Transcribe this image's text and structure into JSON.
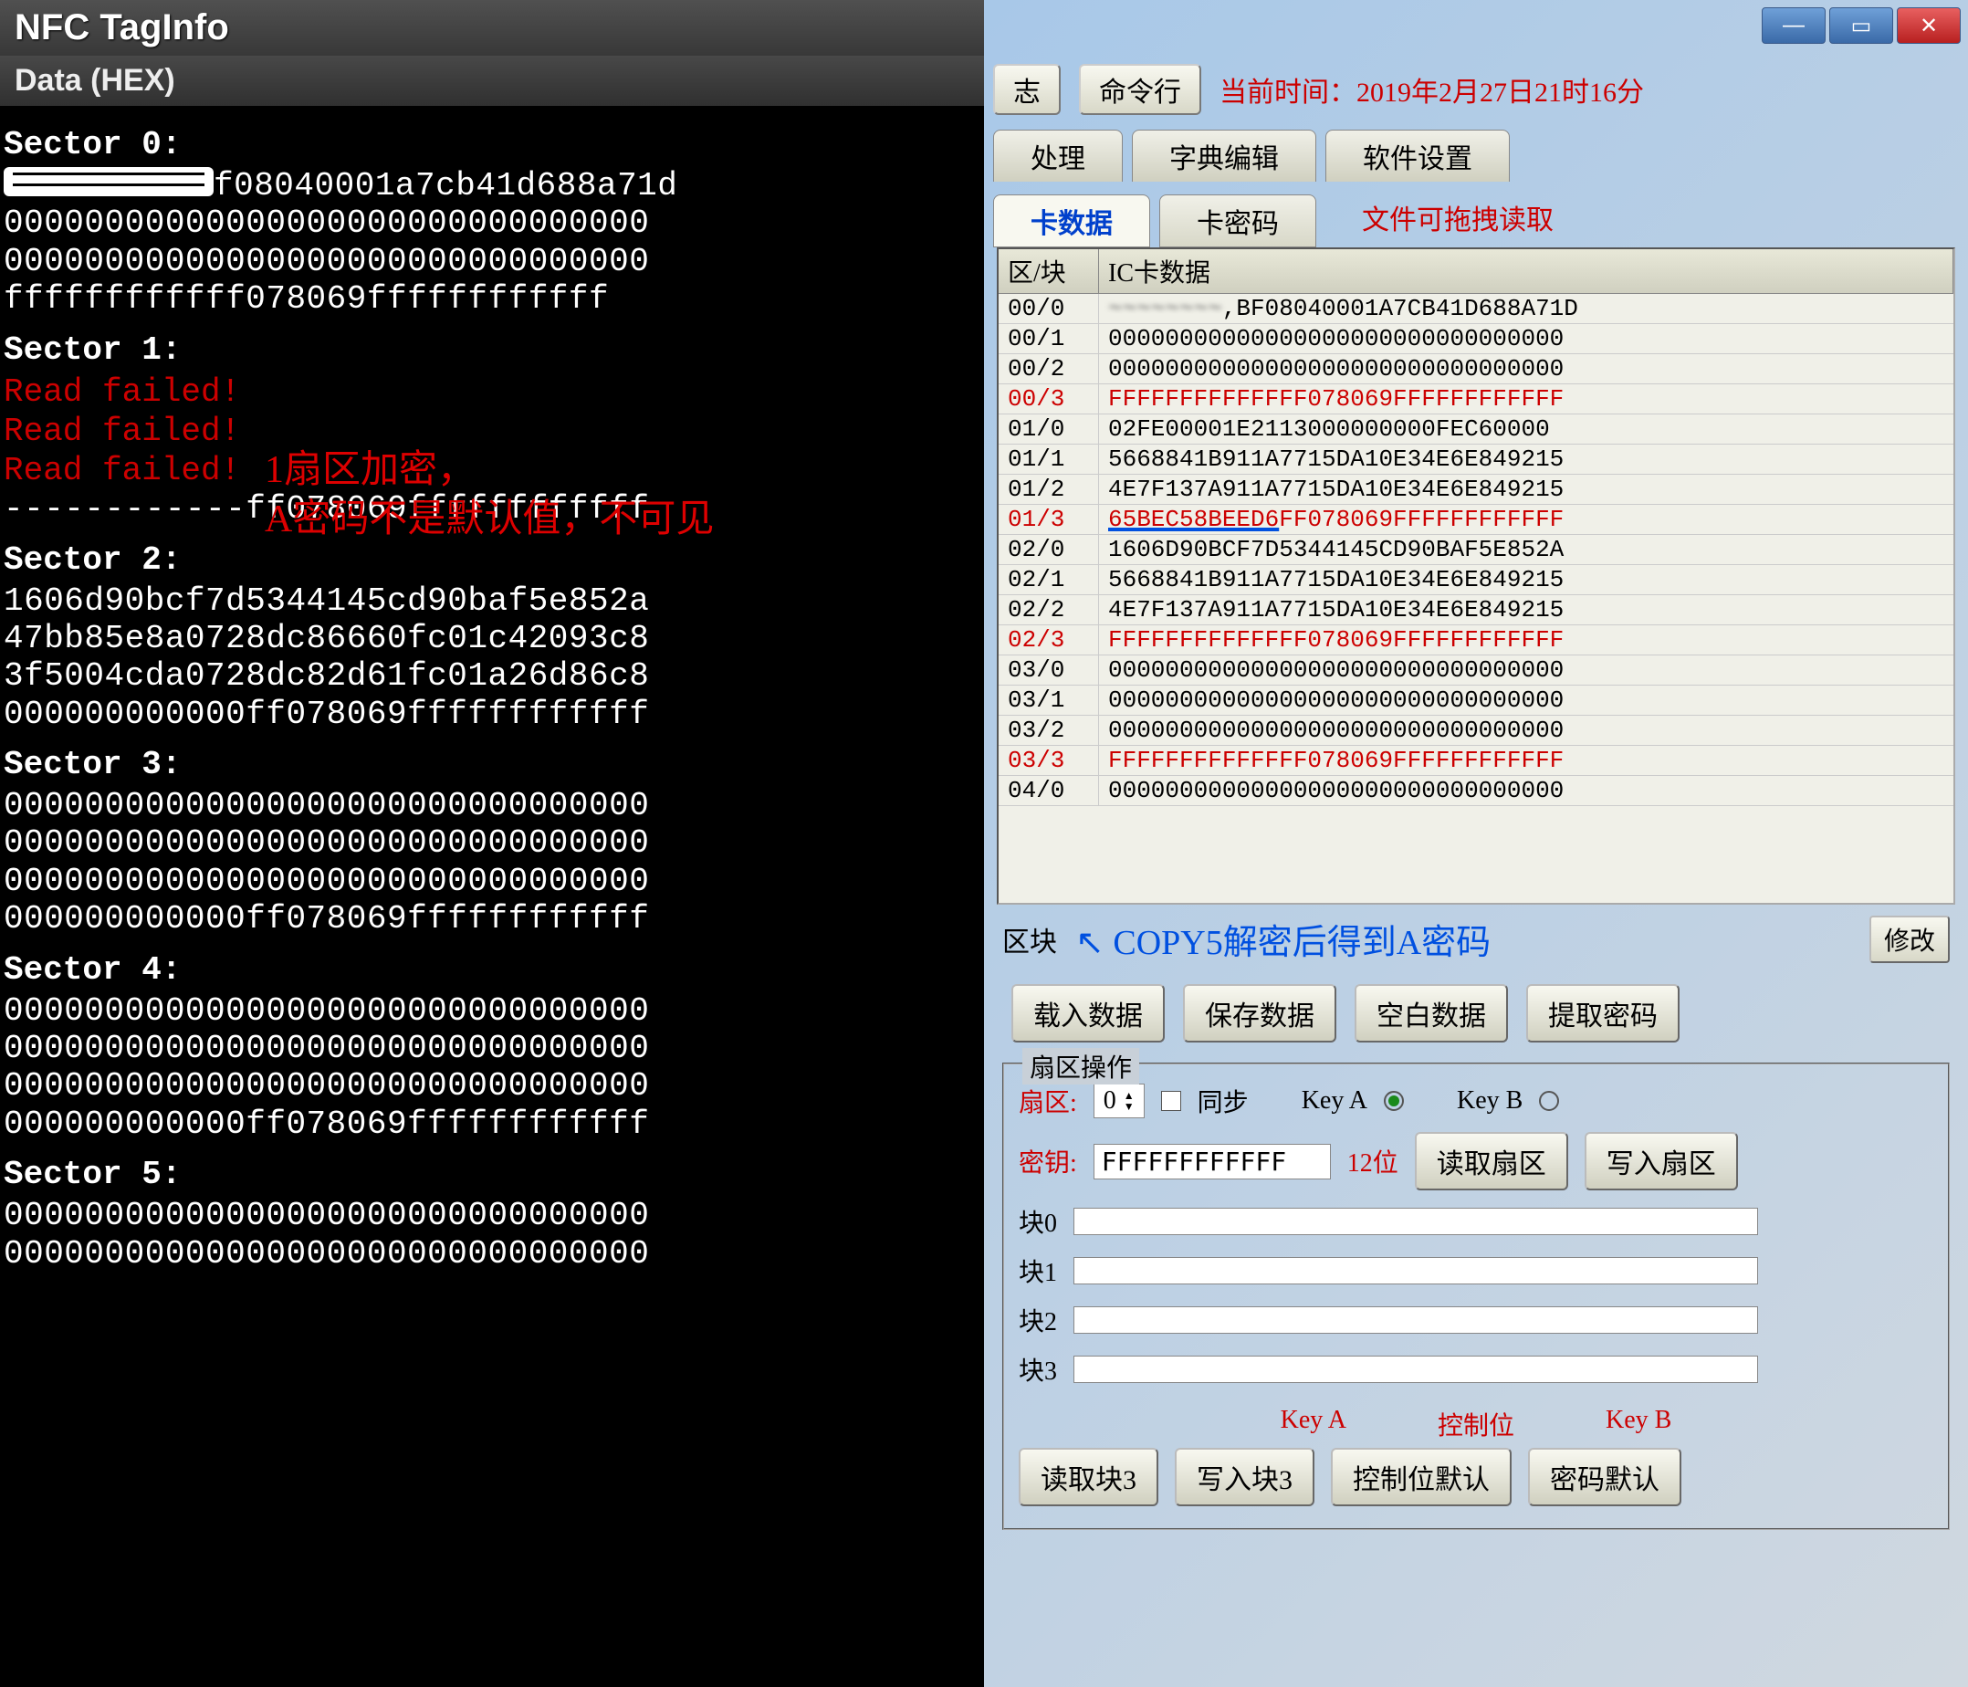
{
  "left": {
    "app_title": "NFC TagInfo",
    "data_header": "Data (HEX)",
    "sectors": [
      {
        "label": "Sector 0:",
        "lines": [
          {
            "t": "redact-prefix",
            "text": "f08040001a7cb41d688a71d"
          },
          {
            "t": "plain",
            "text": "00000000000000000000000000000000"
          },
          {
            "t": "plain",
            "text": "00000000000000000000000000000000"
          },
          {
            "t": "plain",
            "text": "ffffffffffff078069ffffffffffff"
          }
        ]
      },
      {
        "label": "Sector 1:",
        "lines": [
          {
            "t": "fail",
            "text": "Read failed!"
          },
          {
            "t": "fail",
            "text": "Read failed!"
          },
          {
            "t": "fail",
            "text": "Read failed!"
          },
          {
            "t": "plain",
            "text": "------------ff078069ffffffffffff"
          }
        ]
      },
      {
        "label": "Sector 2:",
        "lines": [
          {
            "t": "plain",
            "text": "1606d90bcf7d5344145cd90baf5e852a"
          },
          {
            "t": "plain",
            "text": "47bb85e8a0728dc86660fc01c42093c8"
          },
          {
            "t": "plain",
            "text": "3f5004cda0728dc82d61fc01a26d86c8"
          },
          {
            "t": "plain",
            "text": "000000000000ff078069ffffffffffff"
          }
        ]
      },
      {
        "label": "Sector 3:",
        "lines": [
          {
            "t": "plain",
            "text": "00000000000000000000000000000000"
          },
          {
            "t": "plain",
            "text": "00000000000000000000000000000000"
          },
          {
            "t": "plain",
            "text": "00000000000000000000000000000000"
          },
          {
            "t": "plain",
            "text": "000000000000ff078069ffffffffffff"
          }
        ]
      },
      {
        "label": "Sector 4:",
        "lines": [
          {
            "t": "plain",
            "text": "00000000000000000000000000000000"
          },
          {
            "t": "plain",
            "text": "00000000000000000000000000000000"
          },
          {
            "t": "plain",
            "text": "00000000000000000000000000000000"
          },
          {
            "t": "plain",
            "text": "000000000000ff078069ffffffffffff"
          }
        ]
      },
      {
        "label": "Sector 5:",
        "lines": [
          {
            "t": "plain",
            "text": "00000000000000000000000000000000"
          },
          {
            "t": "plain",
            "text": "00000000000000000000000000000000"
          }
        ]
      }
    ],
    "annotation_line1": "1扇区加密，",
    "annotation_line2": "A密码不是默认值，不可见"
  },
  "right": {
    "btn_log": "志",
    "btn_cmd": "命令行",
    "time_prefix": "当前时间：",
    "time_value": "2019年2月27日21时16分",
    "tab_process": "处理",
    "tab_dict": "字典编辑",
    "tab_settings": "软件设置",
    "subtab_data": "卡数据",
    "subtab_pwd": "卡密码",
    "drag_hint": "文件可拖拽读取",
    "th_sector": "区/块",
    "th_data": "IC卡数据",
    "rows": [
      {
        "s": "00/0",
        "d": "~~~~~~~~,BF08040001A7CB41D688A71D",
        "red": false,
        "redact": true
      },
      {
        "s": "00/1",
        "d": "00000000000000000000000000000000",
        "red": false
      },
      {
        "s": "00/2",
        "d": "00000000000000000000000000000000",
        "red": false
      },
      {
        "s": "00/3",
        "d": "FFFFFFFFFFFFFF078069FFFFFFFFFFFF",
        "red": true
      },
      {
        "s": "01/0",
        "d": "02FE00001E2113000000000FEC60000",
        "red": false
      },
      {
        "s": "01/1",
        "d": "5668841B911A7715DA10E34E6E849215",
        "red": false
      },
      {
        "s": "01/2",
        "d": "4E7F137A911A7715DA10E34E6E849215",
        "red": false
      },
      {
        "s": "01/3",
        "d": "65BEC58BEED6FF078069FFFFFFFFFFFF",
        "red": true,
        "key": true
      },
      {
        "s": "02/0",
        "d": "1606D90BCF7D5344145CD90BAF5E852A",
        "red": false
      },
      {
        "s": "02/1",
        "d": "5668841B911A7715DA10E34E6E849215",
        "red": false
      },
      {
        "s": "02/2",
        "d": "4E7F137A911A7715DA10E34E6E849215",
        "red": false
      },
      {
        "s": "02/3",
        "d": "FFFFFFFFFFFFFF078069FFFFFFFFFFFF",
        "red": true
      },
      {
        "s": "03/0",
        "d": "00000000000000000000000000000000",
        "red": false
      },
      {
        "s": "03/1",
        "d": "00000000000000000000000000000000",
        "red": false
      },
      {
        "s": "03/2",
        "d": "00000000000000000000000000000000",
        "red": false
      },
      {
        "s": "03/3",
        "d": "FFFFFFFFFFFFFF078069FFFFFFFFFFFF",
        "red": true
      },
      {
        "s": "04/0",
        "d": "00000000000000000000000000000000",
        "red": false
      }
    ],
    "block_label": "区块",
    "blue_annotation": "COPY5解密后得到A密码",
    "btn_modify": "修改",
    "btn_load": "载入数据",
    "btn_save": "保存数据",
    "btn_blank": "空白数据",
    "btn_extract": "提取密码",
    "group_title": "扇区操作",
    "sector_label": "扇区:",
    "sector_value": "0",
    "sync_label": "同步",
    "keya_label": "Key A",
    "keyb_label": "Key B",
    "key_label": "密钥:",
    "key_value": "FFFFFFFFFFFF",
    "key_len": "12位",
    "btn_read_sector": "读取扇区",
    "btn_write_sector": "写入扇区",
    "block0": "块0",
    "block1": "块1",
    "block2": "块2",
    "block3": "块3",
    "lbl_keya": "Key A",
    "lbl_ctrl": "控制位",
    "lbl_keyb": "Key B",
    "btn_read3": "读取块3",
    "btn_write3": "写入块3",
    "btn_ctrl_default": "控制位默认",
    "btn_pwd_default": "密码默认"
  }
}
